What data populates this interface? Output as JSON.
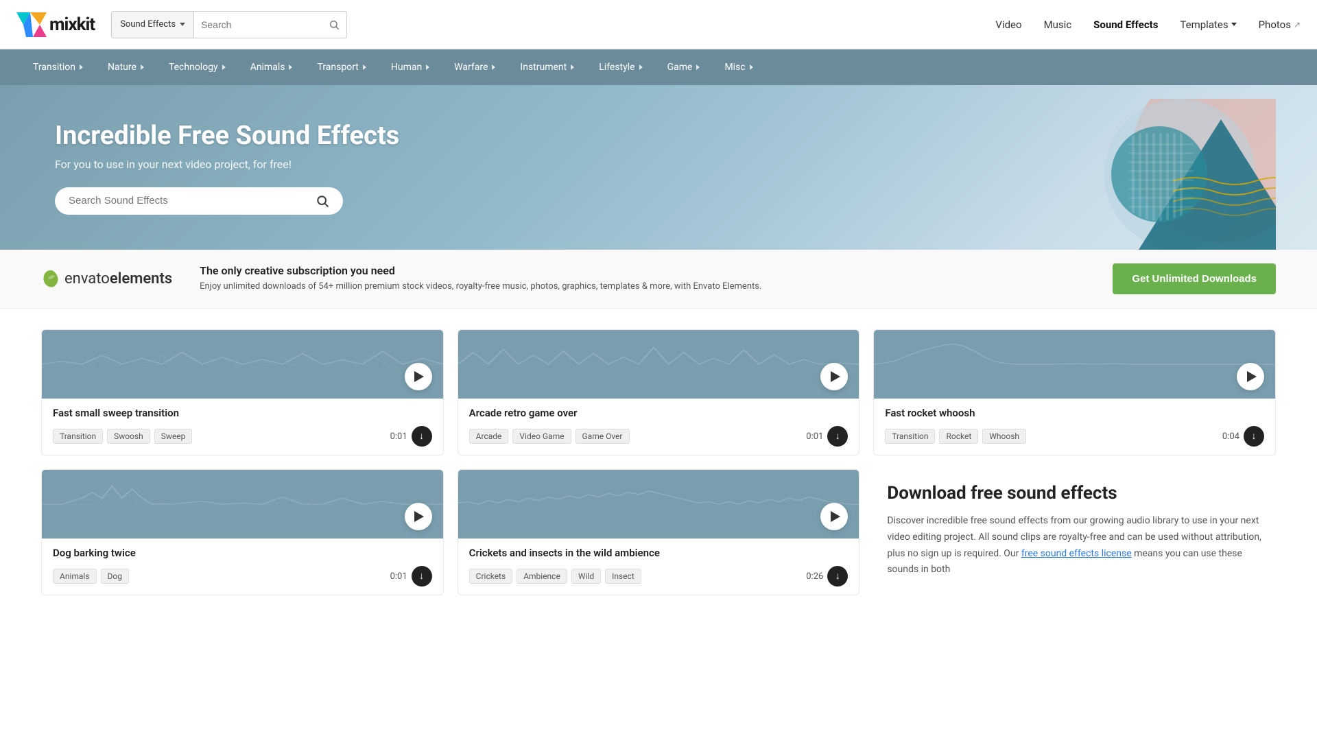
{
  "brand": {
    "name": "mixkit"
  },
  "navbar": {
    "search_category": "Sound Effects",
    "search_placeholder": "Search",
    "links": [
      {
        "label": "Video",
        "active": false
      },
      {
        "label": "Music",
        "active": false
      },
      {
        "label": "Sound Effects",
        "active": true
      },
      {
        "label": "Templates",
        "active": false,
        "has_arrow": true
      },
      {
        "label": "Photos",
        "active": false,
        "has_external": true
      }
    ]
  },
  "categories": [
    {
      "label": "Transition",
      "has_arrow": true
    },
    {
      "label": "Nature",
      "has_arrow": true
    },
    {
      "label": "Technology",
      "has_arrow": true
    },
    {
      "label": "Animals",
      "has_arrow": true
    },
    {
      "label": "Transport",
      "has_arrow": true
    },
    {
      "label": "Human",
      "has_arrow": true
    },
    {
      "label": "Warfare",
      "has_arrow": true
    },
    {
      "label": "Instrument",
      "has_arrow": true
    },
    {
      "label": "Lifestyle",
      "has_arrow": true
    },
    {
      "label": "Game",
      "has_arrow": true
    },
    {
      "label": "Misc",
      "has_arrow": true
    }
  ],
  "hero": {
    "title": "Incredible Free Sound Effects",
    "subtitle": "For you to use in your next video project, for free!",
    "search_placeholder": "Search Sound Effects"
  },
  "envato": {
    "logo_prefix": "envato",
    "logo_suffix": "elements",
    "tagline": "The only creative subscription you need",
    "description": "Enjoy unlimited downloads of 54+ million premium stock videos, royalty-free music, photos, graphics, templates & more, with Envato Elements.",
    "cta": "Get Unlimited Downloads"
  },
  "sound_cards": [
    {
      "title": "Fast small sweep transition",
      "tags": [
        "Transition",
        "Swoosh",
        "Sweep"
      ],
      "duration": "0:01"
    },
    {
      "title": "Arcade retro game over",
      "tags": [
        "Arcade",
        "Video Game",
        "Game Over"
      ],
      "duration": "0:01"
    },
    {
      "title": "Fast rocket whoosh",
      "tags": [
        "Transition",
        "Rocket",
        "Whoosh"
      ],
      "duration": "0:04"
    },
    {
      "title": "Dog barking twice",
      "tags": [
        "Animals",
        "Dog"
      ],
      "duration": "0:01"
    },
    {
      "title": "Crickets and insects in the wild ambience",
      "tags": [
        "Crickets",
        "Ambience",
        "Wild",
        "Insect"
      ],
      "duration": "0:26"
    }
  ],
  "download_section": {
    "title": "Download free sound effects",
    "body": "Discover incredible free sound effects from our growing audio library to use in your next video editing project. All sound clips are royalty-free and can be used without attribution, plus no sign up is required. Our ",
    "link_text": "free sound effects license",
    "body_end": " means you can use these sounds in both"
  }
}
